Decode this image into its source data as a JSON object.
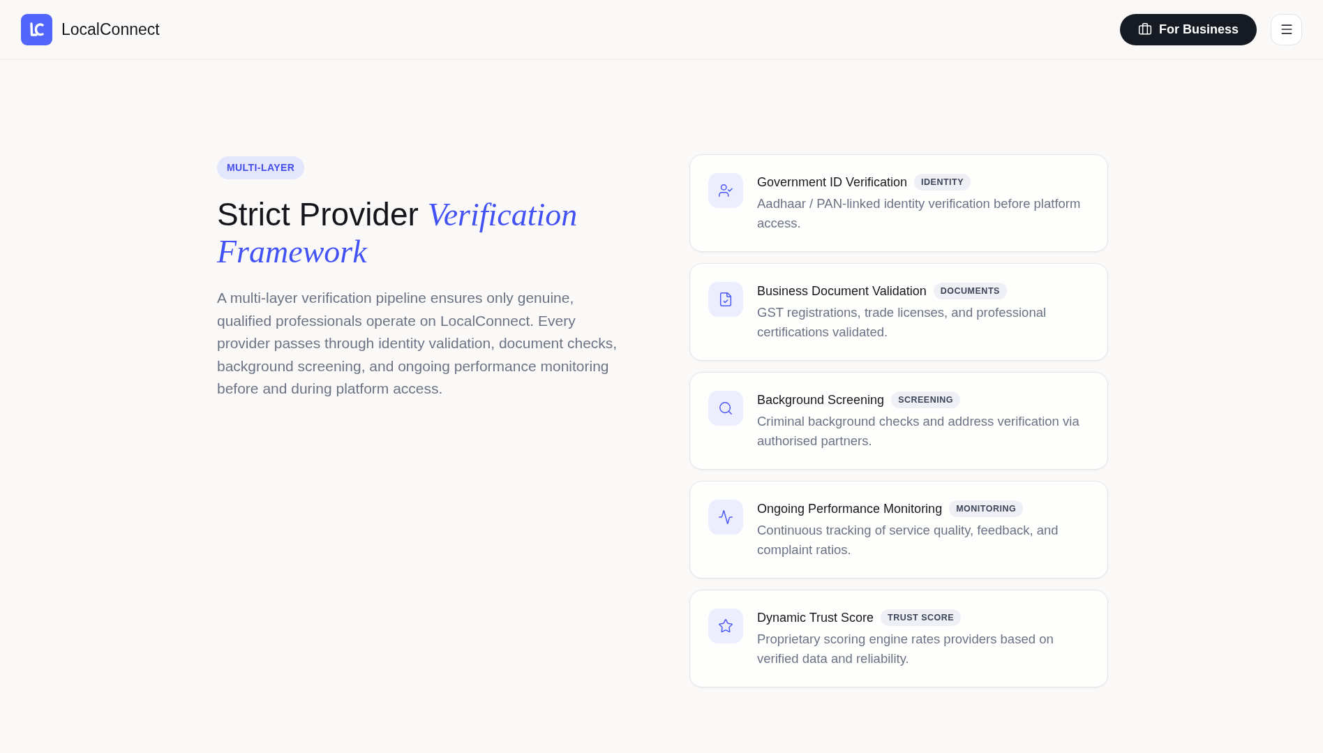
{
  "header": {
    "brand": "LocalConnect",
    "business_button": "For Business"
  },
  "intro": {
    "badge": "MULTI-LAYER",
    "heading": "Strict Provider *Verification Framework*",
    "body": "A multi-layer verification pipeline ensures only genuine, qualified professionals operate on LocalConnect. Every provider passes through identity validation, document checks, background screening, and ongoing performance monitoring before and during platform access."
  },
  "cards": [
    {
      "title": "Government ID Verification",
      "tag": "IDENTITY",
      "description": "Aadhaar / PAN-linked identity verification before platform access."
    },
    {
      "title": "Business Document Validation",
      "tag": "DOCUMENTS",
      "description": "GST registrations, trade licenses, and professional certifications validated."
    },
    {
      "title": "Background Screening",
      "tag": "SCREENING",
      "description": "Criminal background checks and address verification via authorised partners."
    },
    {
      "title": "Ongoing Performance Monitoring",
      "tag": "MONITORING",
      "description": "Continuous tracking of service quality, feedback, and complaint ratios."
    },
    {
      "title": "Dynamic Trust Score",
      "tag": "TRUST SCORE",
      "description": "Proprietary scoring engine rates providers based on verified data and reliability."
    }
  ]
}
